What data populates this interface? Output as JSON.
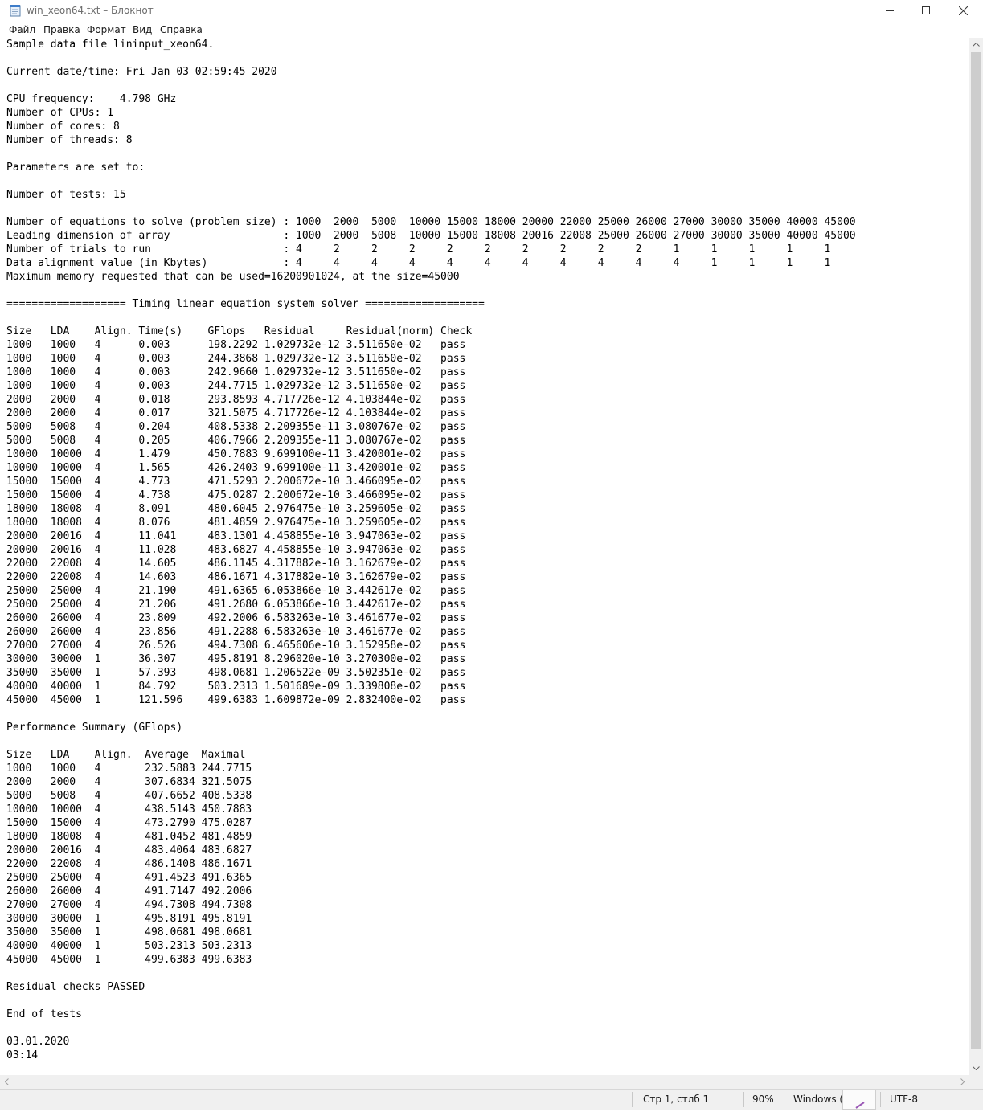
{
  "window": {
    "title": "win_xeon64.txt – Блокнот",
    "icon": "notepad-icon"
  },
  "menu": {
    "items": [
      "Файл",
      "Правка",
      "Формат",
      "Вид",
      "Справка"
    ]
  },
  "document": {
    "lines": [
      "Sample data file lininput_xeon64.",
      "",
      "Current date/time: Fri Jan 03 02:59:45 2020",
      "",
      "CPU frequency:    4.798 GHz",
      "Number of CPUs: 1",
      "Number of cores: 8",
      "Number of threads: 8",
      "",
      "Parameters are set to:",
      "",
      "Number of tests: 15",
      "",
      "Number of equations to solve (problem size) : 1000  2000  5000  10000 15000 18000 20000 22000 25000 26000 27000 30000 35000 40000 45000",
      "Leading dimension of array                  : 1000  2000  5008  10000 15000 18008 20016 22008 25000 26000 27000 30000 35000 40000 45000",
      "Number of trials to run                     : 4     2     2     2     2     2     2     2     2     2     1     1     1     1     1",
      "Data alignment value (in Kbytes)            : 4     4     4     4     4     4     4     4     4     4     4     1     1     1     1",
      "Maximum memory requested that can be used=16200901024, at the size=45000",
      "",
      "=================== Timing linear equation system solver ===================",
      "",
      "Size   LDA    Align. Time(s)    GFlops   Residual     Residual(norm) Check",
      "1000   1000   4      0.003      198.2292 1.029732e-12 3.511650e-02   pass",
      "1000   1000   4      0.003      244.3868 1.029732e-12 3.511650e-02   pass",
      "1000   1000   4      0.003      242.9660 1.029732e-12 3.511650e-02   pass",
      "1000   1000   4      0.003      244.7715 1.029732e-12 3.511650e-02   pass",
      "2000   2000   4      0.018      293.8593 4.717726e-12 4.103844e-02   pass",
      "2000   2000   4      0.017      321.5075 4.717726e-12 4.103844e-02   pass",
      "5000   5008   4      0.204      408.5338 2.209355e-11 3.080767e-02   pass",
      "5000   5008   4      0.205      406.7966 2.209355e-11 3.080767e-02   pass",
      "10000  10000  4      1.479      450.7883 9.699100e-11 3.420001e-02   pass",
      "10000  10000  4      1.565      426.2403 9.699100e-11 3.420001e-02   pass",
      "15000  15000  4      4.773      471.5293 2.200672e-10 3.466095e-02   pass",
      "15000  15000  4      4.738      475.0287 2.200672e-10 3.466095e-02   pass",
      "18000  18008  4      8.091      480.6045 2.976475e-10 3.259605e-02   pass",
      "18000  18008  4      8.076      481.4859 2.976475e-10 3.259605e-02   pass",
      "20000  20016  4      11.041     483.1301 4.458855e-10 3.947063e-02   pass",
      "20000  20016  4      11.028     483.6827 4.458855e-10 3.947063e-02   pass",
      "22000  22008  4      14.605     486.1145 4.317882e-10 3.162679e-02   pass",
      "22000  22008  4      14.603     486.1671 4.317882e-10 3.162679e-02   pass",
      "25000  25000  4      21.190     491.6365 6.053866e-10 3.442617e-02   pass",
      "25000  25000  4      21.206     491.2680 6.053866e-10 3.442617e-02   pass",
      "26000  26000  4      23.809     492.2006 6.583263e-10 3.461677e-02   pass",
      "26000  26000  4      23.856     491.2288 6.583263e-10 3.461677e-02   pass",
      "27000  27000  4      26.526     494.7308 6.465606e-10 3.152958e-02   pass",
      "30000  30000  1      36.307     495.8191 8.296020e-10 3.270300e-02   pass",
      "35000  35000  1      57.393     498.0681 1.206522e-09 3.502351e-02   pass",
      "40000  40000  1      84.792     503.2313 1.501689e-09 3.339808e-02   pass",
      "45000  45000  1      121.596    499.6383 1.609872e-09 2.832400e-02   pass",
      "",
      "Performance Summary (GFlops)",
      "",
      "Size   LDA    Align.  Average  Maximal",
      "1000   1000   4       232.5883 244.7715",
      "2000   2000   4       307.6834 321.5075",
      "5000   5008   4       407.6652 408.5338",
      "10000  10000  4       438.5143 450.7883",
      "15000  15000  4       473.2790 475.0287",
      "18000  18008  4       481.0452 481.4859",
      "20000  20016  4       483.4064 483.6827",
      "22000  22008  4       486.1408 486.1671",
      "25000  25000  4       491.4523 491.6365",
      "26000  26000  4       491.7147 492.2006",
      "27000  27000  4       494.7308 494.7308",
      "30000  30000  1       495.8191 495.8191",
      "35000  35000  1       498.0681 498.0681",
      "40000  40000  1       503.2313 503.2313",
      "45000  45000  1       499.6383 499.6383",
      "",
      "Residual checks PASSED",
      "",
      "End of tests",
      "",
      "03.01.2020",
      "03:14"
    ]
  },
  "status": {
    "position": "Стр 1, стлб 1",
    "zoom": "90%",
    "line_endings": "Windows (C",
    "encoding": "UTF-8"
  }
}
